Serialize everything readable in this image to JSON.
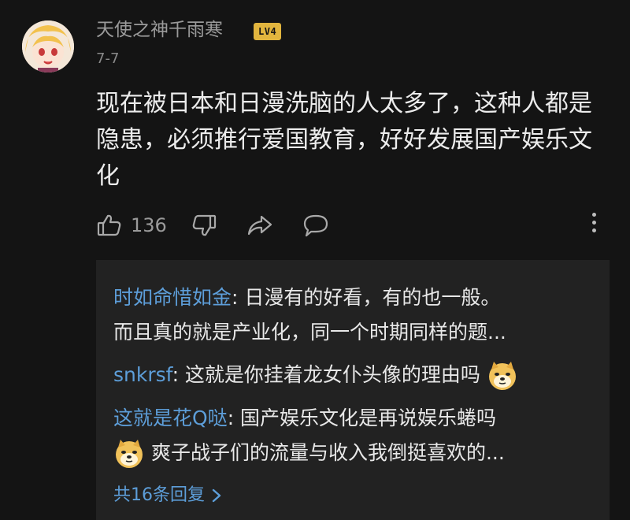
{
  "comment": {
    "author": "天使之神千雨寒",
    "level_badge": "LV4",
    "date": "7-7",
    "text": "现在被日本和日漫洗脑的人太多了，这种人都是\n隐患，必须推行爱国教育，好好发展国产娱乐文\n化",
    "like_count": "136",
    "icons": [
      "thumbs-up-icon",
      "thumbs-down-icon",
      "share-icon",
      "comment-icon",
      "more-vertical-icon"
    ]
  },
  "replies": {
    "items": [
      {
        "author": "时如命惜如金",
        "line1": ": 日漫有的好看，有的也一般。",
        "line2": "而且真的就是产业化，同一个时期同样的题..."
      },
      {
        "author": "snkrsf",
        "line1": ": 这就是你挂着龙女仆头像的理由吗",
        "emoji": "doge-emoji"
      },
      {
        "author": "这就是花Q哒",
        "line1": ": 国产娱乐文化是再说娱乐蜷吗",
        "line2": "爽子战子们的流量与收入我倒挺喜欢的...",
        "emoji": "doge-emoji"
      }
    ],
    "view_all": "共16条回复"
  },
  "colors": {
    "background": "#141414",
    "reply_panel": "#222222",
    "link_blue": "#5d9ed9",
    "badge_gold": "#e2b53e"
  }
}
